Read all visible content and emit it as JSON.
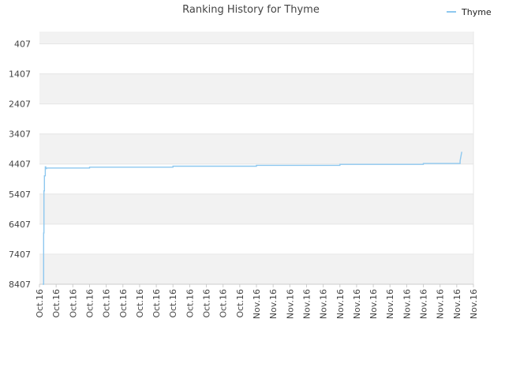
{
  "chart_data": {
    "type": "line",
    "title": "Ranking History for Thyme",
    "xlabel": "",
    "ylabel": "",
    "y_inverted": true,
    "ylim": [
      8407,
      0
    ],
    "y_ticks": [
      407,
      1407,
      2407,
      3407,
      4407,
      5407,
      6407,
      7407,
      8407
    ],
    "x_tick_labels": [
      "Oct.16",
      "Oct.16",
      "Oct.16",
      "Oct.16",
      "Oct.16",
      "Oct.16",
      "Oct.16",
      "Oct.16",
      "Oct.16",
      "Oct.16",
      "Oct.16",
      "Oct.16",
      "Oct.16",
      "Nov.16",
      "Nov.16",
      "Nov.16",
      "Nov.16",
      "Nov.16",
      "Nov.16",
      "Nov.16",
      "Nov.16",
      "Nov.16",
      "Nov.16",
      "Nov.16",
      "Nov.16",
      "Nov.16",
      "Nov.16"
    ],
    "x_range": [
      0,
      26
    ],
    "grid": "alternating horizontal bands",
    "legend_position": "top-right",
    "colors": {
      "series": "#8ec8ef",
      "band": "#f2f2f2",
      "grid": "#e6e6e6"
    },
    "series": [
      {
        "name": "Thyme",
        "x": [
          0.2,
          0.25,
          0.25,
          0.27,
          0.27,
          0.3,
          0.3,
          0.35,
          0.35,
          0.38,
          0.38,
          0.42,
          0.42,
          3.0,
          3.0,
          8.0,
          8.0,
          13.0,
          13.0,
          18.0,
          18.0,
          23.0,
          23.0,
          25.2,
          25.2,
          25.3
        ],
        "values": [
          8407,
          8407,
          6700,
          6700,
          5300,
          5300,
          4800,
          4800,
          4500,
          4500,
          4560,
          4560,
          4540,
          4540,
          4510,
          4510,
          4480,
          4480,
          4450,
          4450,
          4420,
          4420,
          4390,
          4390,
          4300,
          4000
        ]
      }
    ]
  }
}
